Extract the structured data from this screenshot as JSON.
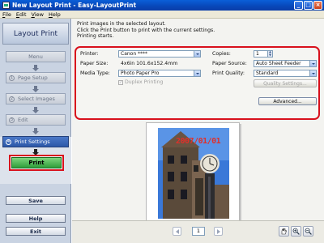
{
  "window": {
    "title": "New Layout Print - Easy-LayoutPrint"
  },
  "menubar": {
    "items": [
      {
        "underlined": "F",
        "rest": "ile"
      },
      {
        "underlined": "E",
        "rest": "dit"
      },
      {
        "underlined": "V",
        "rest": "iew"
      },
      {
        "underlined": "H",
        "rest": "elp"
      }
    ]
  },
  "sidebar": {
    "title": "Layout Print",
    "steps": {
      "menu": "Menu",
      "page_setup": {
        "num": "1",
        "label": "Page Setup"
      },
      "select_images": {
        "num": "2",
        "label": "Select Images"
      },
      "edit": {
        "num": "3",
        "label": "Edit"
      },
      "print_settings": {
        "num": "4",
        "label": "Print Settings"
      }
    },
    "print_label": "Print",
    "save_label": "Save",
    "help_label": "Help",
    "exit_label": "Exit"
  },
  "instructions": {
    "line1": "Print images in the selected layout.",
    "line2": "Click the Print button to print with the current settings.",
    "line3": "Printing starts."
  },
  "settings": {
    "printer_label": "Printer:",
    "printer_value": "Canon ****",
    "paper_size_label": "Paper Size:",
    "paper_size_value": "4x6in 101.6x152.4mm",
    "media_type_label": "Media Type:",
    "media_type_value": "Photo Paper Pro",
    "duplex_label": "Duplex Printing",
    "duplex_checked": "✓",
    "copies_label": "Copies:",
    "copies_value": "1",
    "paper_source_label": "Paper Source:",
    "paper_source_value": "Auto Sheet Feeder",
    "print_quality_label": "Print Quality:",
    "print_quality_value": "Standard",
    "quality_settings_label": "Quality Settings...",
    "advanced_label": "Advanced..."
  },
  "preview": {
    "date_stamp": "2007/01/01",
    "page_number": "1"
  },
  "icons": {
    "hand": "hand-icon",
    "zoom_in": "zoom-in-icon",
    "zoom_out": "zoom-out-icon"
  },
  "colors": {
    "titlebar": "#0847b8",
    "highlight_border": "#d8101c",
    "active_step": "#2c58a8",
    "print_button": "#2e9e3a",
    "date_stamp": "#e0302a"
  }
}
